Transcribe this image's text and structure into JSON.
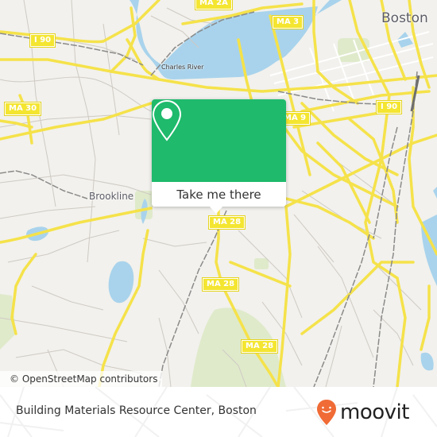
{
  "map": {
    "place_labels": [
      {
        "id": "boston",
        "text": "Boston"
      },
      {
        "id": "brookline",
        "text": "Brookline"
      },
      {
        "id": "charles-river",
        "text": "Charles River"
      }
    ],
    "road_shields": [
      {
        "id": "ma2a",
        "text": "MA 2A"
      },
      {
        "id": "ma3",
        "text": "MA 3"
      },
      {
        "id": "i90-west",
        "text": "I 90"
      },
      {
        "id": "i90-east",
        "text": "I 90"
      },
      {
        "id": "ma30",
        "text": "MA 30"
      },
      {
        "id": "ma9",
        "text": "MA 9"
      },
      {
        "id": "ma28-a",
        "text": "MA 28"
      },
      {
        "id": "ma28-b",
        "text": "MA 28"
      },
      {
        "id": "ma28-c",
        "text": "MA 28"
      }
    ],
    "attribution": "© OpenStreetMap contributors"
  },
  "popup": {
    "button_label": "Take me there",
    "icon": "map-pin-icon",
    "color": "#1fba6c"
  },
  "footer": {
    "title": "Building Materials Resource Center, Boston",
    "brand": "moovit",
    "brand_color": "#f06b35"
  }
}
